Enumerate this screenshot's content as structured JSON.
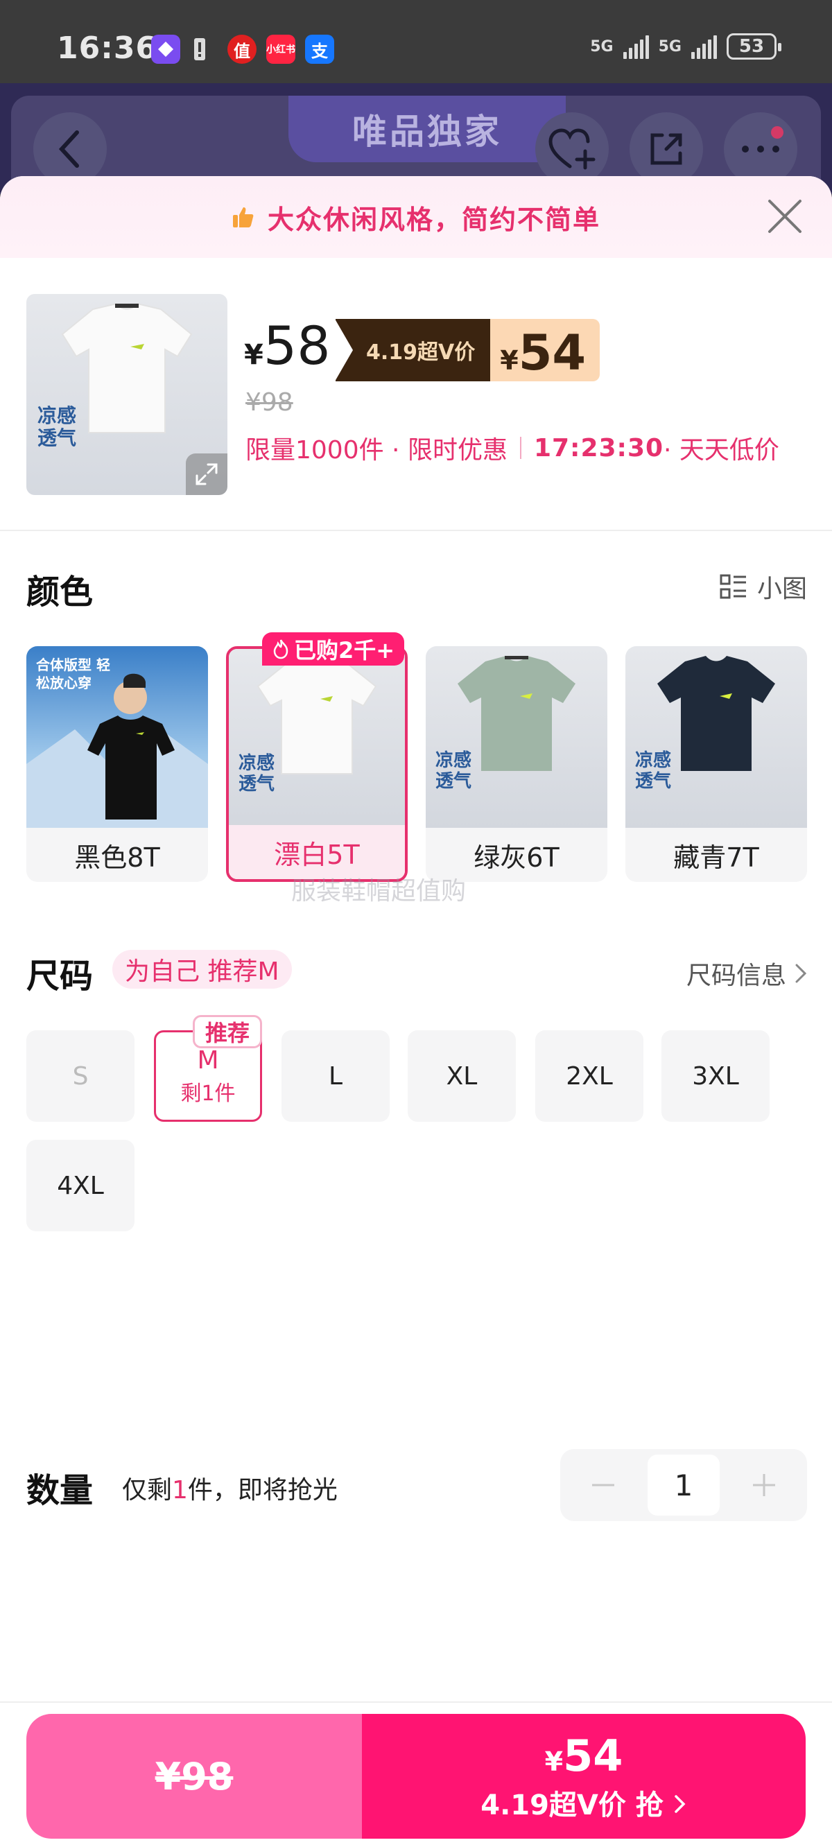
{
  "status_bar": {
    "time": "16:36",
    "apps": [
      "值",
      "小红书",
      "支"
    ],
    "signal_labels": [
      "5G",
      "5G"
    ],
    "battery": "53"
  },
  "background_header": {
    "title": "唯品独家"
  },
  "promo_banner": {
    "text": "大众休闲风格，简约不简单"
  },
  "product": {
    "price_symbol": "¥",
    "price": "58",
    "svip_label": "4.19超V价",
    "svip_price": "54",
    "original_price": "¥98",
    "limit_text": "限量1000件 · 限时优惠",
    "countdown": "17:23:30",
    "tail_text": " · 天天低价",
    "image_caption": "凉感透气"
  },
  "color_section": {
    "title": "颜色",
    "view_toggle_label": "小图",
    "bought_badge": "已购2千+",
    "options": [
      {
        "label": "黑色8T",
        "caption": "合体版型 轻松放心穿"
      },
      {
        "label": "漂白5T",
        "caption": "凉感透气"
      },
      {
        "label": "绿灰6T",
        "caption": "凉感透气"
      },
      {
        "label": "藏青7T",
        "caption": "凉感透气"
      }
    ],
    "watermark": "服装鞋帽超值购"
  },
  "size_section": {
    "title": "尺码",
    "hint": "为自己 推荐M",
    "info_label": "尺码信息",
    "recommend_badge": "推荐",
    "sizes": [
      {
        "label": "S",
        "sub": ""
      },
      {
        "label": "M",
        "sub": "剩1件"
      },
      {
        "label": "L",
        "sub": ""
      },
      {
        "label": "XL",
        "sub": ""
      },
      {
        "label": "2XL",
        "sub": ""
      },
      {
        "label": "3XL",
        "sub": ""
      },
      {
        "label": "4XL",
        "sub": ""
      }
    ]
  },
  "quantity_section": {
    "title": "数量",
    "stock_prefix": "仅剩",
    "stock_count": "1",
    "stock_suffix": "件，即将抢光",
    "value": "1"
  },
  "buy_bar": {
    "original_price": "¥98",
    "price_symbol": "¥",
    "price": "54",
    "cta": "4.19超V价 抢"
  },
  "colors": {
    "accent": "#e6306d",
    "buy_right": "#ff1472",
    "buy_left": "#ff67ac",
    "svip_dark": "#3b2410",
    "svip_light": "#fcd8b4"
  }
}
